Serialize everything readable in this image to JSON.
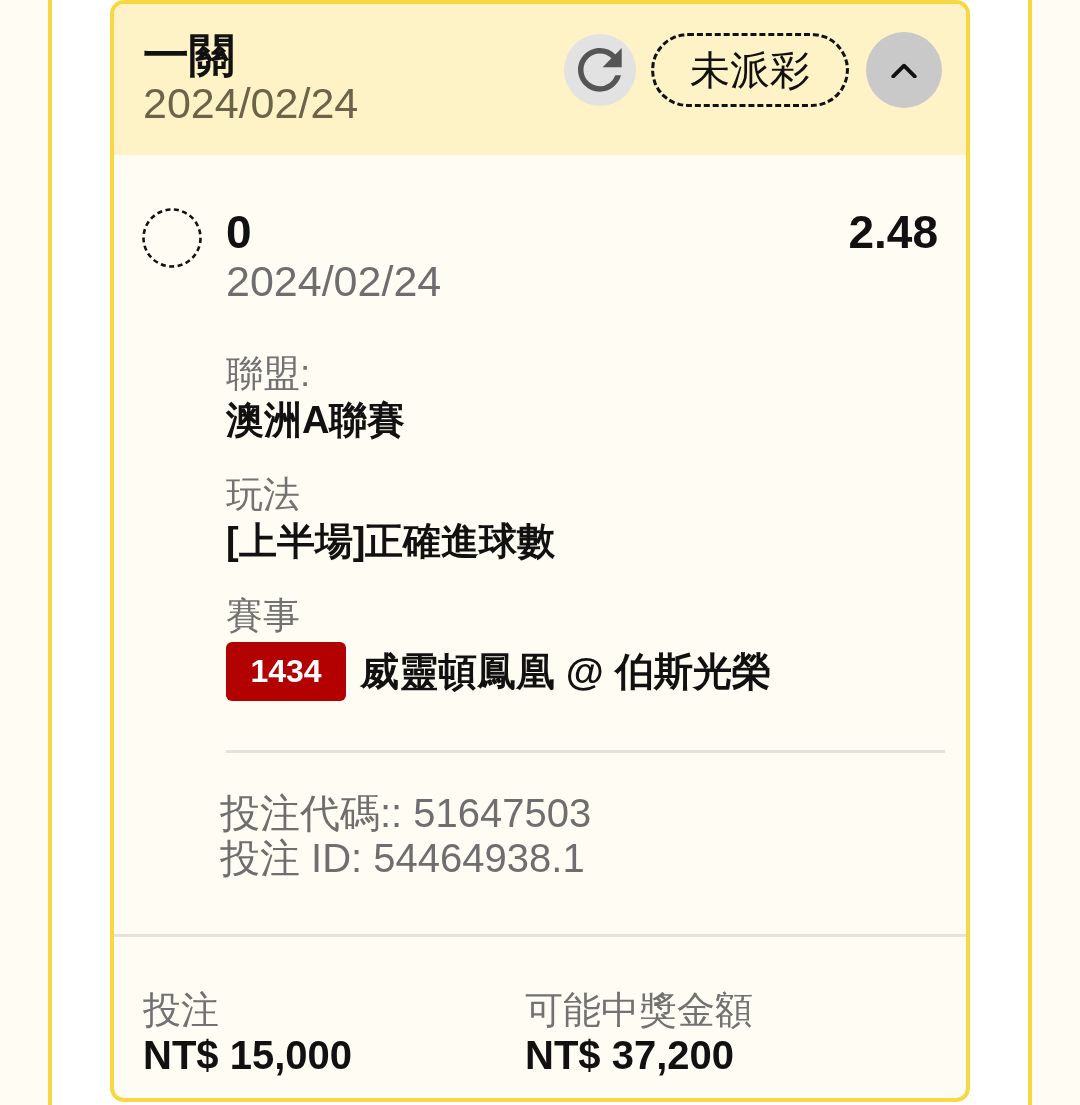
{
  "bet": {
    "title": "一關",
    "date": "2024/02/24",
    "status": "未派彩",
    "expanded": true
  },
  "selection": {
    "settled": false,
    "pick": "0",
    "odds": "2.48",
    "date": "2024/02/24",
    "fields": [
      {
        "label": "聯盟:",
        "value": "澳洲A聯賽"
      },
      {
        "label": "玩法",
        "value": "[上半場]正確進球數"
      }
    ],
    "event": {
      "label": "賽事",
      "match_number": "1434",
      "teams": "威靈頓鳳凰 @ 伯斯光榮"
    },
    "references": [
      "投注代碼:: 51647503",
      "投注 ID: 54464938.1"
    ]
  },
  "summary": [
    {
      "label": "投注",
      "amount": "NT$ 15,000"
    },
    {
      "label": "可能中獎金額",
      "amount": "NT$ 37,200"
    }
  ]
}
